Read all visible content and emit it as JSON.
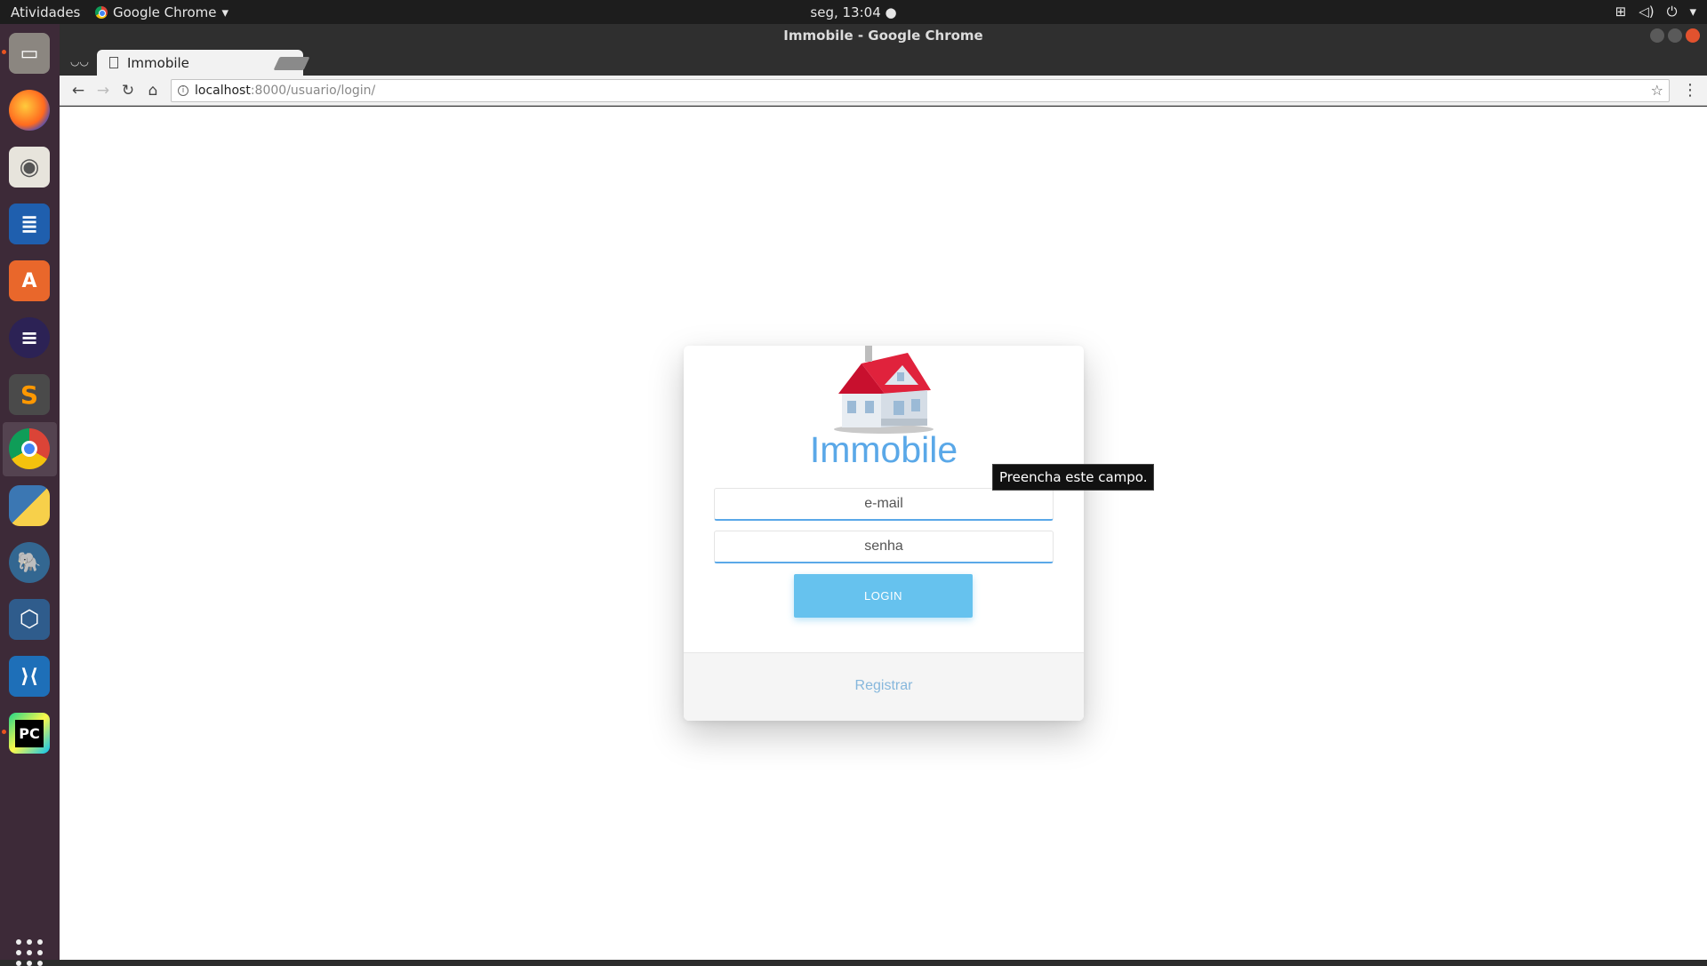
{
  "topbar": {
    "activities": "Atividades",
    "app_menu": "Google Chrome",
    "clock": "seg, 13:04 ●"
  },
  "window": {
    "title": "Immobile - Google Chrome"
  },
  "tab": {
    "title": "Immobile"
  },
  "address_bar": {
    "host": "localhost",
    "rest": ":8000/usuario/login/"
  },
  "login": {
    "brand": "Immobile",
    "email_placeholder": "e-mail",
    "password_placeholder": "senha",
    "login_button": "LOGIN",
    "register_link": "Registrar"
  },
  "tooltip": "Preencha este campo.",
  "dock": {
    "items": [
      "files-icon",
      "firefox-icon",
      "rhythmbox-icon",
      "writer-icon",
      "software-center-icon",
      "eclipse-icon",
      "sublime-icon",
      "chrome-icon",
      "python-icon",
      "postgres-icon",
      "virtualbox-icon",
      "vscode-icon",
      "pycharm-icon"
    ]
  },
  "colors": {
    "accent": "#5aa8e8",
    "button": "#66c2ee",
    "dock_bg": "#3d2a38"
  }
}
